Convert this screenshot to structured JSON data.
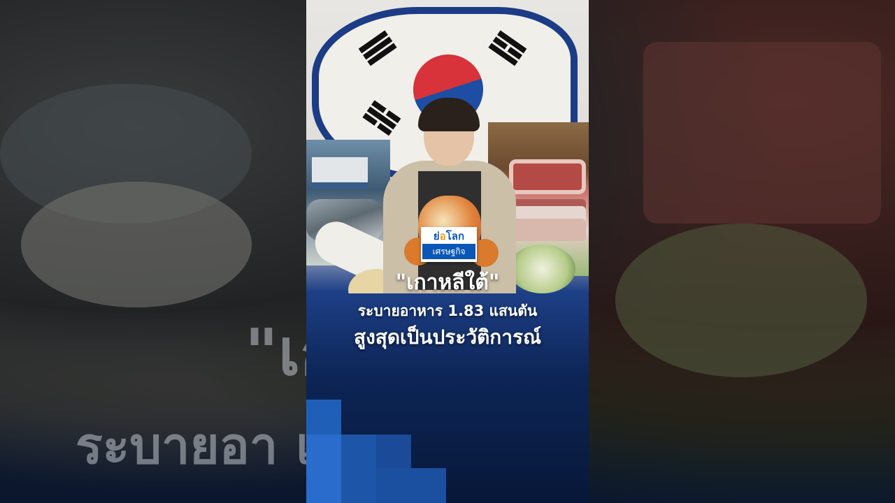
{
  "background_text": {
    "line1": "\"เกาหลีใต้\"",
    "line2": "ระบายอา          แสนตัน"
  },
  "logo": {
    "top_a": "ย่",
    "top_b": "อ",
    "top_c": "โลก",
    "bottom": "เศรษฐกิจ"
  },
  "headline": {
    "line1": "\"เกาหลีใต้\"",
    "line2": "ระบายอาหาร 1.83 แสนตัน",
    "line3": "สูงสุดเป็นประวัติการณ์"
  },
  "colors": {
    "flag_red": "#d8323a",
    "flag_blue": "#1d4ea3",
    "logo_blue": "#0a57b7",
    "accent_yellow": "#e6a21b",
    "bg_navy": "#0d2556"
  }
}
